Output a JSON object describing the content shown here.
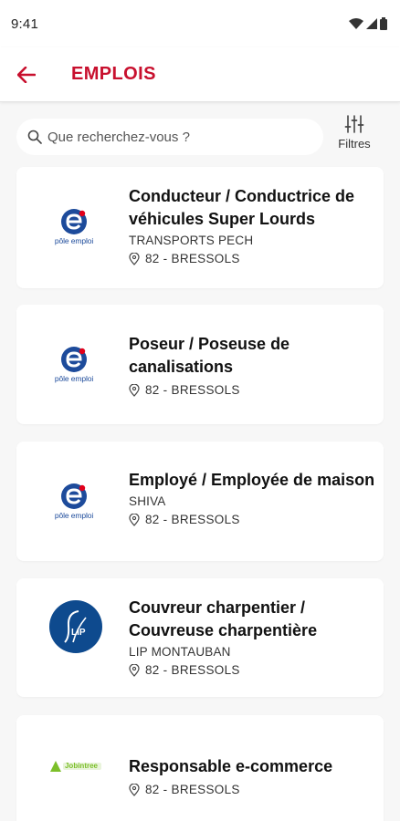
{
  "status_bar": {
    "time": "9:41"
  },
  "header": {
    "title": "EMPLOIS",
    "back_label": "Retour"
  },
  "search": {
    "placeholder": "Que recherchez-vous ?",
    "filters_label": "Filtres"
  },
  "colors": {
    "accent": "#c8102e",
    "pole_emploi_blue": "#1d4b9b",
    "pole_emploi_red": "#e2001a",
    "lip_blue": "#0e4a8e",
    "jobintree_green": "#7cbf2a"
  },
  "logos": {
    "pole_emploi": "pôle emploi",
    "lip": "LIP",
    "jobintree": "Jobintree"
  },
  "jobs": [
    {
      "title": "Conducteur / Conductrice de véhicules Super Lourds",
      "company": "TRANSPORTS PECH",
      "location": "82 - BRESSOLS",
      "logo": "pole-emploi"
    },
    {
      "title": "Poseur / Poseuse de canalisations",
      "company": "",
      "location": "82 - BRESSOLS",
      "logo": "pole-emploi"
    },
    {
      "title": "Employé / Employée de maison",
      "company": "SHIVA",
      "location": "82 - BRESSOLS",
      "logo": "pole-emploi"
    },
    {
      "title": "Couvreur charpentier / Couvreuse charpentière",
      "company": "LIP MONTAUBAN",
      "location": "82 - BRESSOLS",
      "logo": "lip"
    },
    {
      "title": "Responsable e-commerce",
      "company": "",
      "location": "82 - BRESSOLS",
      "logo": "jobintree"
    }
  ]
}
